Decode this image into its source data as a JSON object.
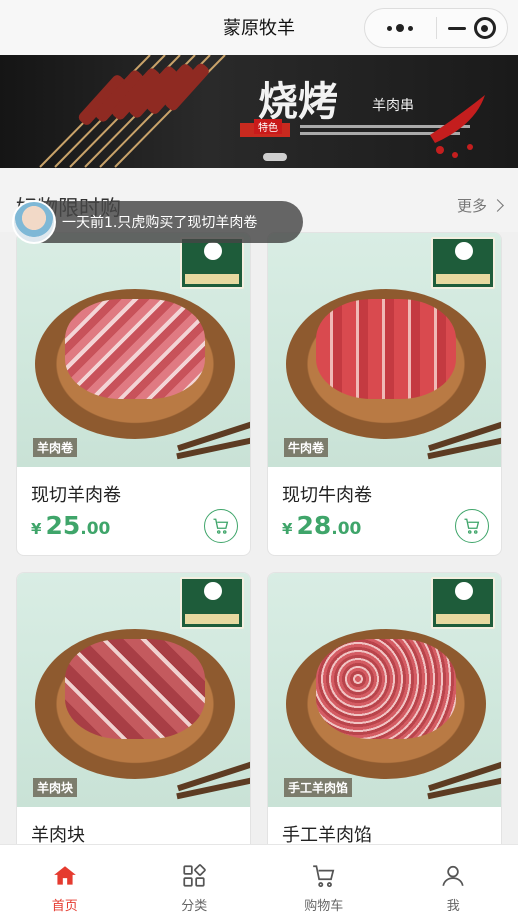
{
  "app": {
    "title": "蒙原牧羊"
  },
  "capsule": {
    "more_icon": "more-dots-icon",
    "minimize_icon": "minimize-icon",
    "close_icon": "target-icon"
  },
  "banner": {
    "dot_count": 1,
    "tag": "特色"
  },
  "section": {
    "title": "好物限时购",
    "more_label": "更多"
  },
  "notice": {
    "text": "一天前1.只虎购买了现切羊肉卷"
  },
  "products": [
    {
      "name": "现切羊肉卷",
      "image_label": "羊肉卷",
      "currency": "¥",
      "price_int": "25",
      "price_dec": ".00",
      "meat": "lamb-roll"
    },
    {
      "name": "现切牛肉卷",
      "image_label": "牛肉卷",
      "currency": "¥",
      "price_int": "28",
      "price_dec": ".00",
      "meat": "beef-roll"
    },
    {
      "name": "羊肉块",
      "image_label": "羊肉块",
      "currency": "¥",
      "price_int": "",
      "price_dec": "",
      "meat": "lamb-cube"
    },
    {
      "name": "手工羊肉馅",
      "image_label": "手工羊肉馅",
      "currency": "¥",
      "price_int": "",
      "price_dec": "",
      "meat": "mince"
    }
  ],
  "tabs": [
    {
      "label": "首页",
      "icon": "home-icon",
      "active": true
    },
    {
      "label": "分类",
      "icon": "category-icon",
      "active": false
    },
    {
      "label": "购物车",
      "icon": "cart-icon",
      "active": false
    },
    {
      "label": "我",
      "icon": "user-icon",
      "active": false
    }
  ],
  "colors": {
    "accent_green": "#3fa56a",
    "active_tab": "#e53b2f"
  }
}
